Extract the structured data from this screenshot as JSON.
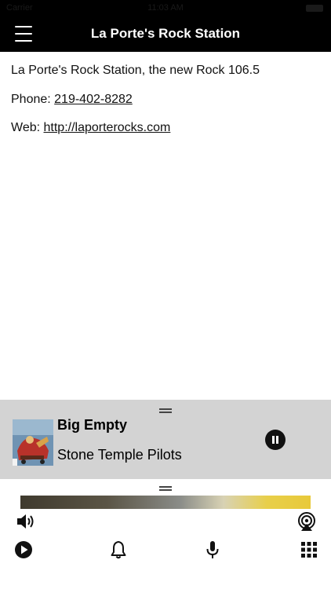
{
  "status_bar": {
    "carrier": "Carrier",
    "time": "11:03 AM"
  },
  "header": {
    "title": "La Porte's Rock Station"
  },
  "content": {
    "description": "La Porte's Rock Station, the new Rock 106.5",
    "phone_label": "Phone: ",
    "phone_value": "219-402-8282",
    "web_label": "Web: ",
    "web_value": "http://laporterocks.com"
  },
  "now_playing": {
    "title": "Big Empty",
    "artist": "Stone Temple Pilots",
    "state": "playing"
  },
  "icons": {
    "menu": "hamburger-menu-icon",
    "pause": "pause-icon",
    "volume": "speaker-volume-icon",
    "airplay": "airplay-icon",
    "play": "play-icon",
    "notifications": "bell-icon",
    "microphone": "microphone-icon",
    "grid": "grid-menu-icon"
  },
  "colors": {
    "header_bg": "#000000",
    "player_bg": "#d3d3d3"
  }
}
